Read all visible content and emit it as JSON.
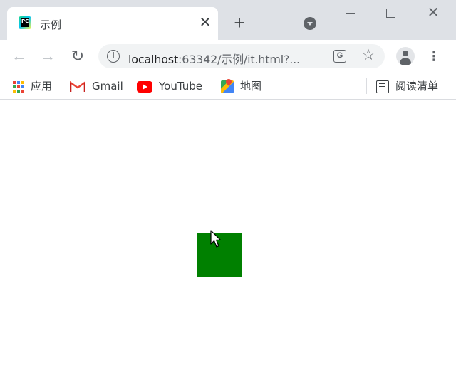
{
  "tab": {
    "title": "示例",
    "favicon_text": "PC",
    "close_glyph": "✕"
  },
  "tabstrip": {
    "new_tab_glyph": "+",
    "close_glyph": "✕"
  },
  "toolbar": {
    "back_glyph": "←",
    "forward_glyph": "→",
    "reload_glyph": "↻",
    "url_host": "localhost",
    "url_path": ":63342/示例/it.html?...",
    "info_glyph": "i",
    "translate_glyph": "G",
    "star_glyph": "☆",
    "menu_glyph": "⋮"
  },
  "bookmarks": [
    {
      "label": "应用",
      "icon": "apps-grid-icon"
    },
    {
      "label": "Gmail",
      "icon": "gmail-icon"
    },
    {
      "label": "YouTube",
      "icon": "youtube-icon"
    },
    {
      "label": "地图",
      "icon": "maps-icon"
    }
  ],
  "reading_list": {
    "label": "阅读清单",
    "icon": "reading-list-icon"
  },
  "page": {
    "box_color": "#008000"
  },
  "colors": {
    "tabstrip_bg": "#dee1e6",
    "accent_green": "#008000",
    "youtube_red": "#ff0000"
  }
}
